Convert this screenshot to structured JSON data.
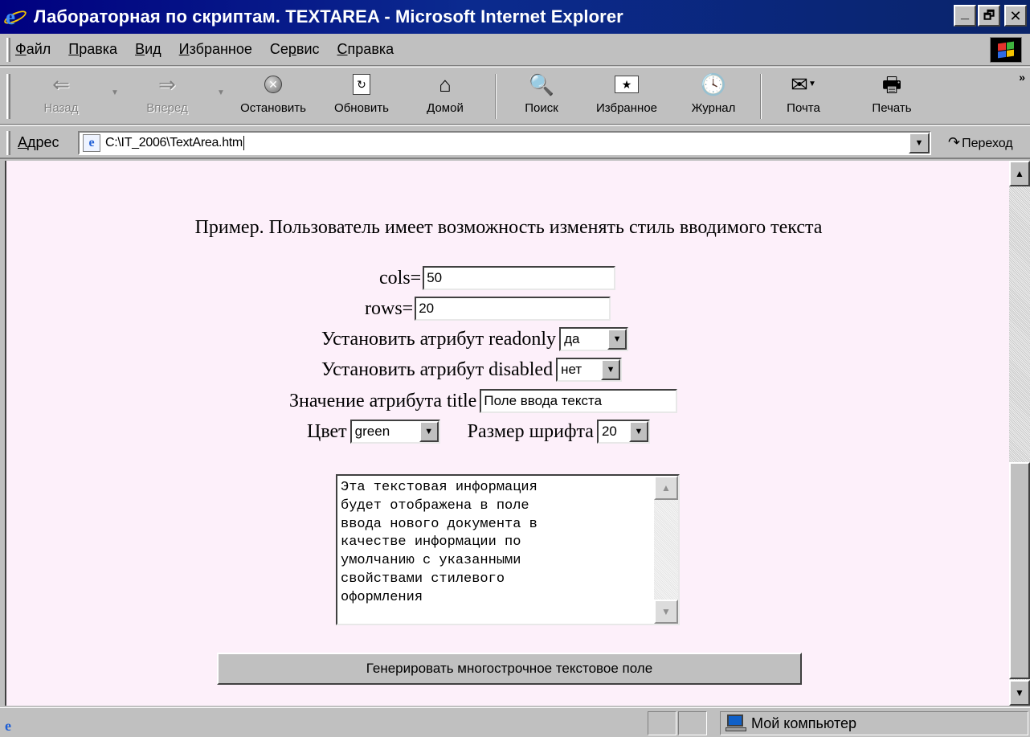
{
  "window": {
    "title": "Лабораторная по скриптам. TEXTAREA - Microsoft Internet Explorer",
    "controls": {
      "minimize": "_",
      "maximize": "🗗",
      "close": "✕"
    }
  },
  "menu": {
    "items": [
      {
        "key": "Ф",
        "rest": "айл"
      },
      {
        "key": "П",
        "rest": "равка"
      },
      {
        "key": "В",
        "rest": "ид"
      },
      {
        "key": "И",
        "rest": "збранное"
      },
      {
        "pre": "Се",
        "key": "р",
        "rest": "вис"
      },
      {
        "key": "С",
        "rest": "правка"
      }
    ]
  },
  "toolbar": {
    "back": "Назад",
    "forward": "Вперед",
    "stop": "Остановить",
    "refresh": "Обновить",
    "home": "Домой",
    "search": "Поиск",
    "favorites": "Избранное",
    "history": "Журнал",
    "mail": "Почта",
    "print": "Печать",
    "more": "»"
  },
  "address": {
    "label_key": "А",
    "label_rest": "дрес",
    "value": "C:\\IT_2006\\TextArea.htm",
    "go": "Переход"
  },
  "page": {
    "heading": "Пример. Пользователь имеет возможность изменять стиль вводимого текста",
    "cols_label": "cols=",
    "cols_value": "50",
    "rows_label": "rows=",
    "rows_value": "20",
    "readonly_label": "Установить атрибут readonly",
    "readonly_value": "да",
    "disabled_label": "Установить атрибут disabled",
    "disabled_value": "нет",
    "title_label": "Значение атрибута title",
    "title_value": "Поле ввода текста",
    "color_label": "Цвет",
    "color_value": "green",
    "fontsize_label": "Размер шрифта",
    "fontsize_value": "20",
    "textarea_lines": [
      "Эта текстовая информация",
      "будет отображена в поле",
      "ввода нового документа в",
      "качестве информации по",
      "умолчанию с указанными",
      "свойствами стилевого",
      "оформления"
    ],
    "generate_button": "Генерировать многострочное текстовое поле"
  },
  "status": {
    "zone": "Мой компьютер"
  }
}
